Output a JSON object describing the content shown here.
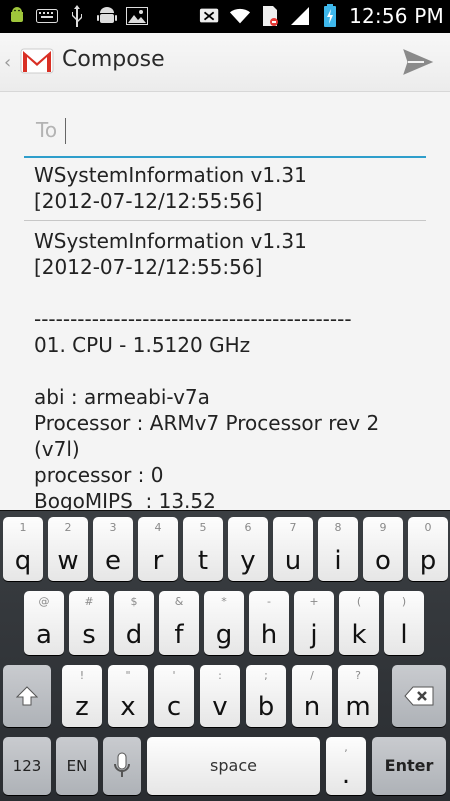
{
  "status_bar": {
    "time": "12:56 PM",
    "left_icons": [
      "android-icon",
      "keyboard-icon",
      "usb-icon",
      "android-debug-icon",
      "gallery-icon"
    ],
    "right_icons": [
      "screen-mirror-icon",
      "wifi-icon",
      "sim-missing-icon",
      "signal-icon",
      "battery-icon"
    ]
  },
  "action_bar": {
    "title": "Compose"
  },
  "compose": {
    "to_label": "To",
    "subject": "WSystemInformation v1.31\n[2012-07-12/12:55:56]",
    "body": "WSystemInformation v1.31\n[2012-07-12/12:55:56]\n\n--------------------------------------------\n01. CPU - 1.5120 GHz\n\nabi : armeabi-v7a\nProcessor : ARMv7 Processor rev 2 (v7l)\nprocessor : 0\nBogoMIPS  : 13.52"
  },
  "keyboard": {
    "row1": [
      {
        "k": "q",
        "h": "1"
      },
      {
        "k": "w",
        "h": "2"
      },
      {
        "k": "e",
        "h": "3"
      },
      {
        "k": "r",
        "h": "4"
      },
      {
        "k": "t",
        "h": "5"
      },
      {
        "k": "y",
        "h": "6"
      },
      {
        "k": "u",
        "h": "7"
      },
      {
        "k": "i",
        "h": "8"
      },
      {
        "k": "o",
        "h": "9"
      },
      {
        "k": "p",
        "h": "0"
      }
    ],
    "row2": [
      {
        "k": "a",
        "h": "@"
      },
      {
        "k": "s",
        "h": "#"
      },
      {
        "k": "d",
        "h": "$"
      },
      {
        "k": "f",
        "h": "&"
      },
      {
        "k": "g",
        "h": "*"
      },
      {
        "k": "h",
        "h": "-"
      },
      {
        "k": "j",
        "h": "+"
      },
      {
        "k": "k",
        "h": "("
      },
      {
        "k": "l",
        "h": ")"
      }
    ],
    "row3": [
      {
        "k": "z",
        "h": "!"
      },
      {
        "k": "x",
        "h": "\""
      },
      {
        "k": "c",
        "h": "'"
      },
      {
        "k": "v",
        "h": ":"
      },
      {
        "k": "b",
        "h": ";"
      },
      {
        "k": "n",
        "h": "/"
      },
      {
        "k": "m",
        "h": "?"
      }
    ],
    "mode_key": "123",
    "lang_key": "EN",
    "space_key": "space",
    "period_key": ".",
    "period_hint": ",",
    "enter_key": "Enter"
  }
}
